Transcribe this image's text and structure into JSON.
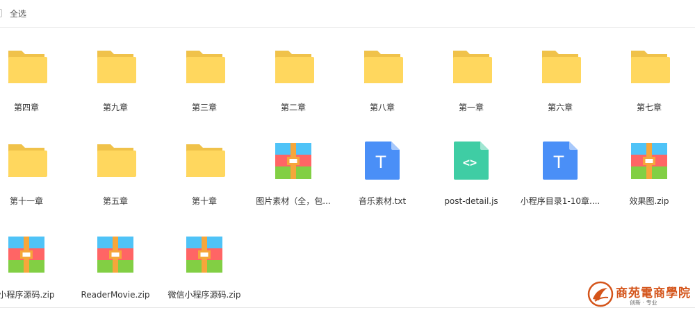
{
  "toolbar": {
    "select_all_label": "全选"
  },
  "items": [
    {
      "type": "folder",
      "label": "第四章"
    },
    {
      "type": "folder",
      "label": "第九章"
    },
    {
      "type": "folder",
      "label": "第三章"
    },
    {
      "type": "folder",
      "label": "第二章"
    },
    {
      "type": "folder",
      "label": "第八章"
    },
    {
      "type": "folder",
      "label": "第一章"
    },
    {
      "type": "folder",
      "label": "第六章"
    },
    {
      "type": "folder",
      "label": "第七章"
    },
    {
      "type": "folder",
      "label": "第十一章"
    },
    {
      "type": "folder",
      "label": "第五章"
    },
    {
      "type": "folder",
      "label": "第十章"
    },
    {
      "type": "zip",
      "label": "图片素材（全，包..."
    },
    {
      "type": "txt",
      "label": "音乐素材.txt",
      "glyph": "T"
    },
    {
      "type": "js",
      "label": "post-detail.js",
      "glyph": "<>"
    },
    {
      "type": "txt",
      "label": "小程序目录1-10章....",
      "glyph": "T"
    },
    {
      "type": "zip",
      "label": "效果图.zip"
    },
    {
      "type": "zip",
      "label": "小程序源码.zip"
    },
    {
      "type": "zip",
      "label": "ReaderMovie.zip"
    },
    {
      "type": "zip",
      "label": "微信小程序源码.zip"
    }
  ],
  "icon_names": {
    "folder": "folder-icon",
    "zip": "zip-archive-icon",
    "txt": "text-file-icon",
    "js": "code-file-icon"
  },
  "colors": {
    "folder_back": "#f0c24a",
    "folder_front": "#ffd75e",
    "txt_page": "#4a8ff7",
    "txt_fold": "#a7c8fb",
    "js_page": "#3fcda4",
    "js_fold": "#a0e6d2",
    "zip_blue": "#4fc3f7",
    "zip_red": "#ff6565",
    "zip_green": "#82cf44",
    "zip_strap": "#f6a63b",
    "watermark": "#d4541a"
  },
  "watermark": {
    "title": "商苑電商學院",
    "subtitle": "创新 · 专业"
  }
}
